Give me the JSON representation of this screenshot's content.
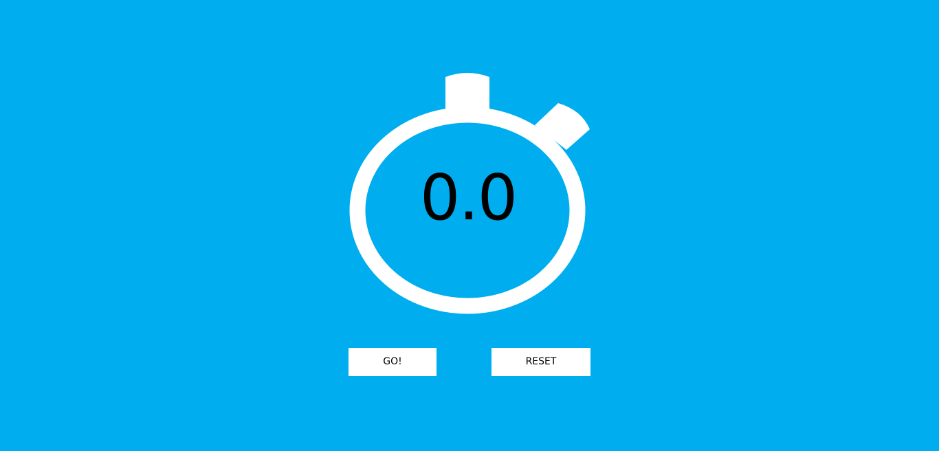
{
  "stopwatch": {
    "time": "0.0"
  },
  "controls": {
    "go_label": "GO!",
    "reset_label": "RESET"
  },
  "colors": {
    "background": "#00aef0",
    "foreground": "#ffffff",
    "text": "#000000"
  }
}
